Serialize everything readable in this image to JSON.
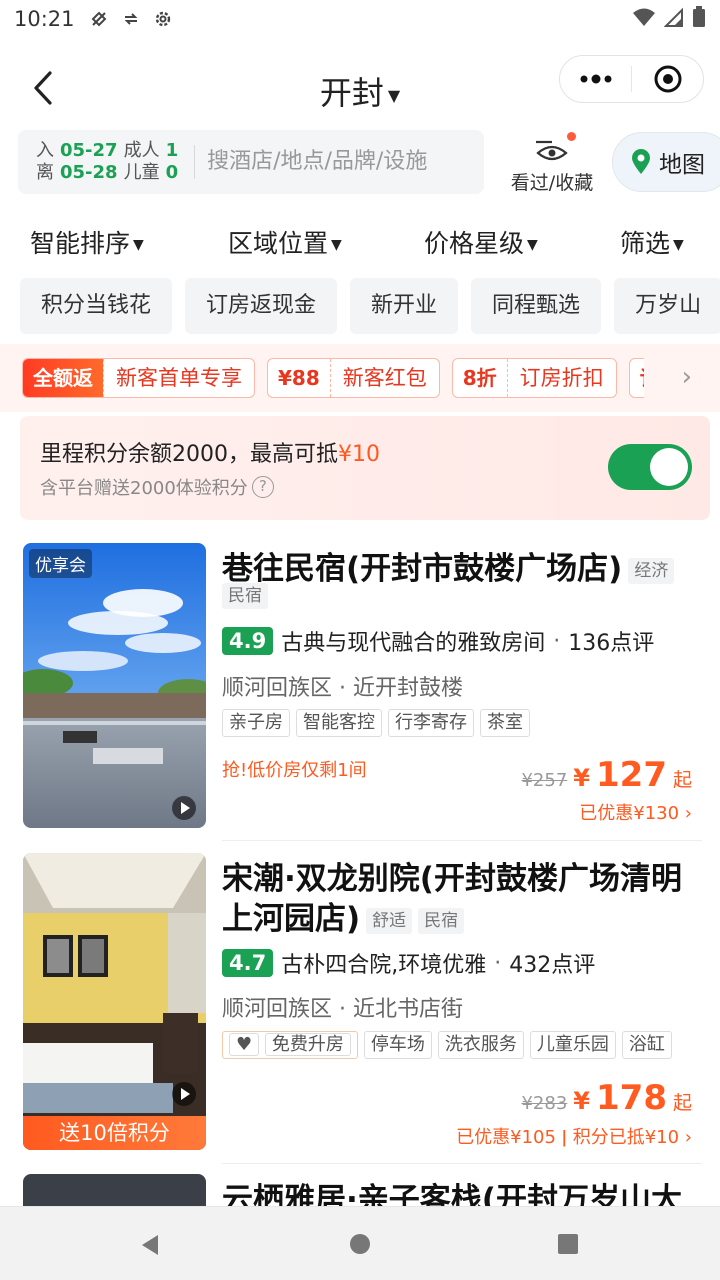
{
  "status_bar": {
    "time": "10:21"
  },
  "header": {
    "title": "开封"
  },
  "search": {
    "checkin_label": "入",
    "checkin_date": "05-27",
    "checkout_label": "离",
    "checkout_date": "05-28",
    "adult_label": "成人",
    "adult_count": "1",
    "child_label": "儿童",
    "child_count": "0",
    "placeholder": "搜酒店/地点/品牌/设施",
    "watch_label": "看过/收藏",
    "map_label": "地图"
  },
  "sort": [
    "智能排序",
    "区域位置",
    "价格星级",
    "筛选"
  ],
  "chips": [
    "积分当钱花",
    "订房返现金",
    "新开业",
    "同程甄选",
    "万岁山"
  ],
  "promos": [
    {
      "left": "全额返",
      "right": "新客首单专享"
    },
    {
      "left": "¥88",
      "right": "新客红包"
    },
    {
      "left": "8折",
      "right": "订房折扣"
    },
    {
      "left": "订",
      "right": ""
    }
  ],
  "points": {
    "text_main": "里程积分余额2000，最高可抵",
    "text_amount": "¥10",
    "sub": "含平台赠送2000体验积分",
    "enabled": true
  },
  "hotels": [
    {
      "badge": "优享会",
      "name": "巷往民宿(开封市鼓楼广场店)",
      "tags": [
        "经济",
        "民宿"
      ],
      "score": "4.9",
      "highlight": "古典与现代融合的雅致房间",
      "reviews": "136点评",
      "location": "顺河回族区 · 近开封鼓楼",
      "amenities": [
        "亲子房",
        "智能客控",
        "行李寄存",
        "茶室"
      ],
      "hint": "抢!低价房仅剩1间",
      "old_price": "¥257",
      "price_symbol": "¥",
      "price": "127",
      "price_suffix": "起",
      "discount": "已优惠¥130 ›"
    },
    {
      "badge": "送10倍积分",
      "name_line1": "宋潮·双龙别院(开封鼓楼广场清明",
      "name_line2": "上河园店)",
      "tags": [
        "舒适",
        "民宿"
      ],
      "score": "4.7",
      "highlight": "古朴四合院,环境优雅",
      "reviews": "432点评",
      "location": "顺河回族区 · 近北书店街",
      "upgrade": "免费升房",
      "amenities": [
        "停车场",
        "洗衣服务",
        "儿童乐园",
        "浴缸"
      ],
      "old_price": "¥283",
      "price_symbol": "¥",
      "price": "178",
      "price_suffix": "起",
      "discount": "已优惠¥105 ǀ 积分已抵¥10 ›"
    },
    {
      "name": "云栖雅居·亲子客栈(开封万岁山大"
    }
  ],
  "colors": {
    "green": "#1aa154",
    "orange": "#ff5a1f",
    "promo_red": "#e8361f"
  }
}
